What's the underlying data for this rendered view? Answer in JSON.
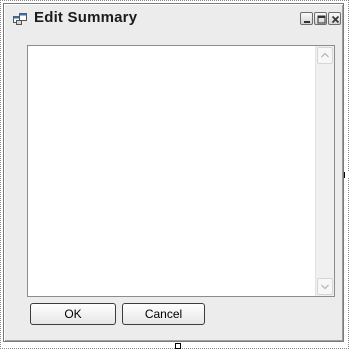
{
  "window": {
    "title": "Edit Summary",
    "icon": "form-icon",
    "controls": [
      "minimize-icon",
      "maximize-icon",
      "close-icon"
    ]
  },
  "memo": {
    "value": "",
    "scrollbar": {
      "up_icon": "chevron-up-icon",
      "down_icon": "chevron-down-icon"
    }
  },
  "buttons": {
    "ok_label": "OK",
    "cancel_label": "Cancel"
  },
  "colors": {
    "window_background": "#ececec",
    "memo_background": "#ffffff",
    "border": "#7a7a7a"
  }
}
